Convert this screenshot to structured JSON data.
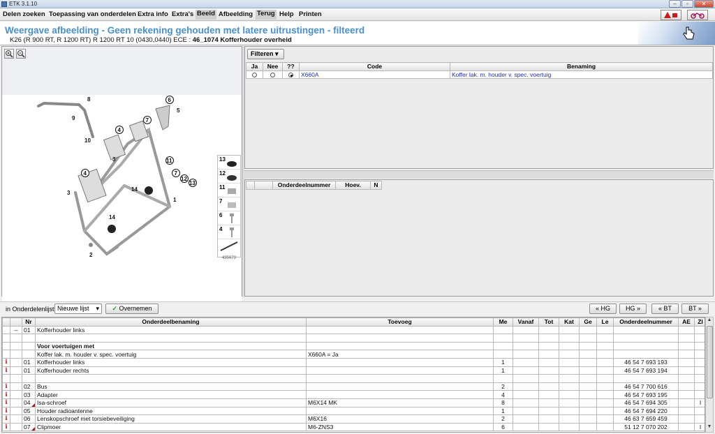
{
  "window": {
    "title": "ETK 3.1.10"
  },
  "menu": [
    "Delen zoeken",
    "Toepassing van onderdelen",
    "Extra info",
    "Extra's",
    "Beeld",
    "Afbeelding",
    "Terug",
    "Help",
    "Printen"
  ],
  "header": {
    "title": "Weergave afbeelding - Geen rekening gehouden met latere uitrustingen - filteerd",
    "subtitle_prefix": "K26 (R 900 RT, R 1200 RT) R 1200 RT 10 (0430,0440) ECE :",
    "subtitle_bold": "46_1074 Kofferhouder overheid"
  },
  "drawing": {
    "callouts": [
      "8",
      "9",
      "6",
      "5",
      "4",
      "7",
      "10",
      "3",
      "11",
      "7",
      "12",
      "13",
      "4",
      "3",
      "14",
      "1",
      "14",
      "2"
    ],
    "thumbs": [
      "13",
      "12",
      "11",
      "7",
      "6",
      "4"
    ],
    "image_id": "435673"
  },
  "filter": {
    "button": "Filteren",
    "columns": [
      "Ja",
      "Nee",
      "??",
      "Code",
      "Benaming"
    ],
    "rows": [
      {
        "code": "X660A",
        "benaming": "Koffer lak. m. houder v. spec. voertuig",
        "selected": "??"
      }
    ]
  },
  "numbers_table": {
    "columns": [
      "",
      "",
      "Onderdeelnummer",
      "Hoev.",
      "N"
    ]
  },
  "bottom_bar": {
    "label": "in Onderdelenlijst",
    "select_value": "Nieuwe lijst",
    "overnemen": "Overnemen",
    "nav": [
      "« HG",
      "HG »",
      "« BT",
      "BT »"
    ]
  },
  "parts": {
    "columns": [
      "",
      "",
      "Nr",
      "Onderdeelbenaming",
      "Toevoeg",
      "Me",
      "Vanaf",
      "Tot",
      "Kat",
      "Ge",
      "Le",
      "Onderdeelnummer",
      "AE",
      "ZI"
    ],
    "rows": [
      {
        "info": "",
        "ind": "–",
        "nr": "01",
        "name": "Kofferhouder links",
        "toevoeg": "",
        "me": "",
        "pn": "",
        "zi": "",
        "flag": false,
        "bold": false
      },
      {
        "info": "",
        "ind": "",
        "nr": "",
        "name": "",
        "toevoeg": "",
        "me": "",
        "pn": "",
        "zi": "",
        "flag": false,
        "bold": false
      },
      {
        "info": "",
        "ind": "",
        "nr": "",
        "name": "Voor voertuigen met",
        "toevoeg": "",
        "me": "",
        "pn": "",
        "zi": "",
        "flag": false,
        "bold": true
      },
      {
        "info": "",
        "ind": "",
        "nr": "",
        "name": "Koffer lak. m. houder v. spec. voertuig",
        "toevoeg": "X660A = Ja",
        "me": "",
        "pn": "",
        "zi": "",
        "flag": false,
        "bold": false
      },
      {
        "info": "i",
        "ind": "",
        "nr": "01",
        "name": "Kofferhouder links",
        "toevoeg": "",
        "me": "1",
        "pn": "46 54 7 693 193",
        "zi": "",
        "flag": false,
        "bold": false
      },
      {
        "info": "i",
        "ind": "",
        "nr": "01",
        "name": "Kofferhouder rechts",
        "toevoeg": "",
        "me": "1",
        "pn": "46 54 7 693 194",
        "zi": "",
        "flag": false,
        "bold": false
      },
      {
        "info": "",
        "ind": "",
        "nr": "",
        "name": "",
        "toevoeg": "",
        "me": "",
        "pn": "",
        "zi": "",
        "flag": false,
        "bold": false
      },
      {
        "info": "i",
        "ind": "",
        "nr": "02",
        "name": "Bus",
        "toevoeg": "",
        "me": "2",
        "pn": "46 54 7 700 616",
        "zi": "",
        "flag": false,
        "bold": false
      },
      {
        "info": "i",
        "ind": "",
        "nr": "03",
        "name": "Adapter",
        "toevoeg": "",
        "me": "4",
        "pn": "46 54 7 693 195",
        "zi": "",
        "flag": false,
        "bold": false
      },
      {
        "info": "i",
        "ind": "",
        "nr": "04",
        "name": "Isa-schroef",
        "toevoeg": "M6X14 MK",
        "me": "8",
        "pn": "46 54 7 694 305",
        "zi": "I",
        "flag": true,
        "bold": false
      },
      {
        "info": "i",
        "ind": "",
        "nr": "05",
        "name": "Houder radioantenne",
        "toevoeg": "",
        "me": "1",
        "pn": "46 54 7 694 220",
        "zi": "",
        "flag": false,
        "bold": false
      },
      {
        "info": "i",
        "ind": "",
        "nr": "06",
        "name": "Lenskopschroef met torsiebeveiliging",
        "toevoeg": "M6X16",
        "me": "2",
        "pn": "46 63 7 659 459",
        "zi": "",
        "flag": false,
        "bold": false
      },
      {
        "info": "i",
        "ind": "",
        "nr": "07",
        "name": "Clipmoer",
        "toevoeg": "M6-ZNS3",
        "me": "6",
        "pn": "51 12 7 070 202",
        "zi": "I",
        "flag": true,
        "bold": false
      }
    ]
  }
}
